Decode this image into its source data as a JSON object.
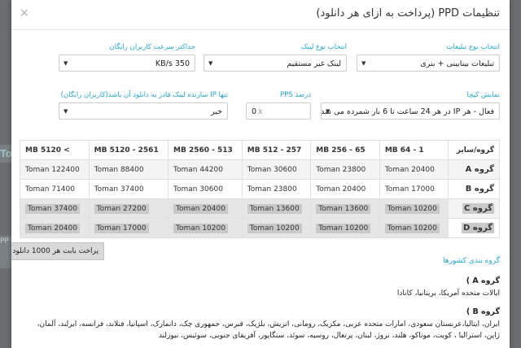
{
  "modal": {
    "title": "تنظیمات PPD (پرداخت به ازای هر دانلود)",
    "close": "×"
  },
  "fields": {
    "ad_type": {
      "label": "انتخاب نوع تبلیغات",
      "value": "تبلیغات بینابینی + بنری"
    },
    "link_type": {
      "label": "انتخاب نوع لینک",
      "value": "لینک غیر مستقیم"
    },
    "max_speed": {
      "label": "حداکثر سرعت کاربران رایگان",
      "value": "350 KB/s"
    },
    "captcha": {
      "label": "نمایش کپچا",
      "value": "فعال - هر IP در هر 24 ساعت تا 6 بار شمرده می شد"
    },
    "pps": {
      "label": "درصد PPS",
      "value": "0",
      "placeholder": "x"
    },
    "ip_only": {
      "label": "تنها IP سازنده لینک قادر به دانلود آن باشد(کاربران رایگان)",
      "value": "خیر"
    }
  },
  "table": {
    "corner_header": "گروه/سایز",
    "columns": [
      "1 - 64 MB",
      "65 - 256 MB",
      "257 - 512 MB",
      "513 - 2560 MB",
      "2561 - 5120 MB",
      "> 5120 MB"
    ],
    "rows": [
      {
        "group": "گروه A",
        "values": [
          "20400 Toman",
          "23800 Toman",
          "30600 Toman",
          "44200 Toman",
          "88400 Toman",
          "122400 Toman"
        ]
      },
      {
        "group": "گروه B",
        "values": [
          "17000 Toman",
          "20400 Toman",
          "23800 Toman",
          "30600 Toman",
          "37400 Toman",
          "71400 Toman"
        ]
      },
      {
        "group": "گروه C",
        "values": [
          "10200 Toman",
          "13600 Toman",
          "13600 Toman",
          "20400 Toman",
          "27200 Toman",
          "37400 Toman"
        ]
      },
      {
        "group": "گروه D",
        "values": [
          "10200 Toman",
          "10200 Toman",
          "10200 Toman",
          "10200 Toman",
          "17000 Toman",
          "20400 Toman"
        ]
      }
    ]
  },
  "pay_button": "پراخت بابت هر 1000 دانلود",
  "countries": {
    "section_title": "گروه بندی کشورها",
    "group_a_title": "گروه A )",
    "group_a_text": "ایالات متحده آمریکا، بریتانیا، کانادا",
    "group_b_title": "گروه B )",
    "group_b_text": "ایران، ایتالیا،عربستان سعودی، امارات متحده عربی، مکزیک، رومانی، اتریش، بلژیک، قبرس، جمهوری چک، دانمارک، اسپانیا، فنلاند، فرانسه، ایرلند، آلمان، ژاپن، استرالیا ، کویت، موناکو، هلند، نروژ، لبنان، پرتغال، روسیه، سوئد، سنگاپور، آفریقای جنوبی، سوئیس، نیوزلند"
  },
  "background": {
    "strip_a": "To",
    "strip_b": "PP"
  }
}
